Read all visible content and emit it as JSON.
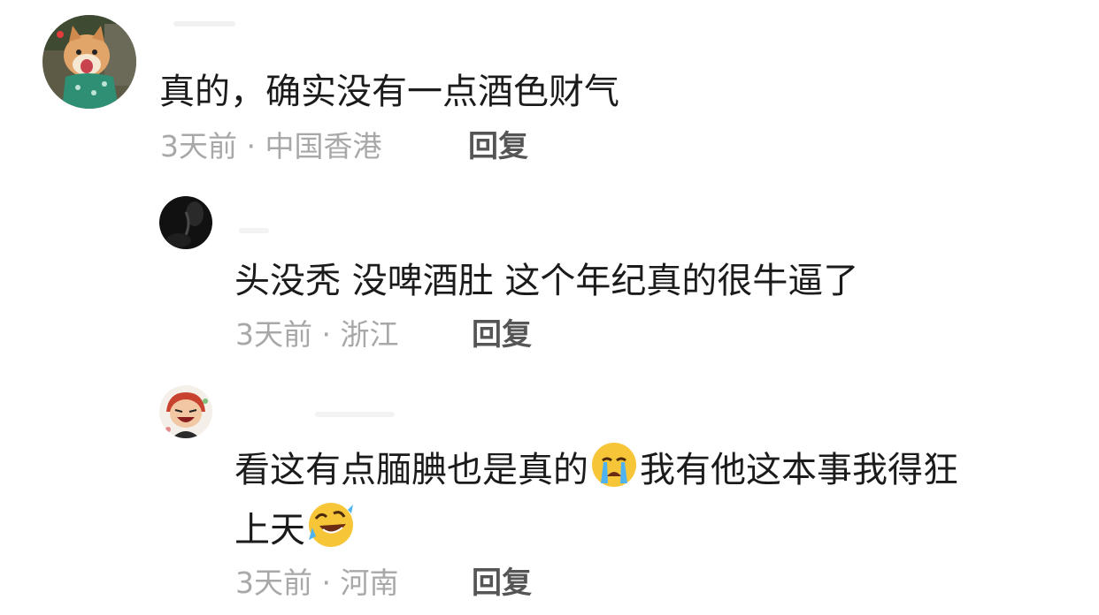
{
  "comments": [
    {
      "avatar_icon": "shiba-dog-avatar-icon",
      "text": "真的，确实没有一点酒色财气",
      "meta": "3天前 · 中国香港",
      "reply_label": "回复"
    },
    {
      "avatar_icon": "dark-photo-avatar-icon",
      "text": "头没秃 没啤酒肚 这个年纪真的很牛逼了",
      "meta": "3天前 · 浙江",
      "reply_label": "回复"
    },
    {
      "avatar_icon": "cartoon-laughing-avatar-icon",
      "text_line1_a": "看这有点腼腆也是真的",
      "emoji1": "loudly-crying-face-icon",
      "text_line1_b": "我有他这本事我得狂",
      "text_line2_a": "上天",
      "emoji2": "rolling-on-floor-laughing-icon",
      "meta": "3天前 · 河南",
      "reply_label": "回复"
    }
  ],
  "colors": {
    "text": "#1b1b1b",
    "meta": "#a8a8a8",
    "reply": "#555555"
  }
}
